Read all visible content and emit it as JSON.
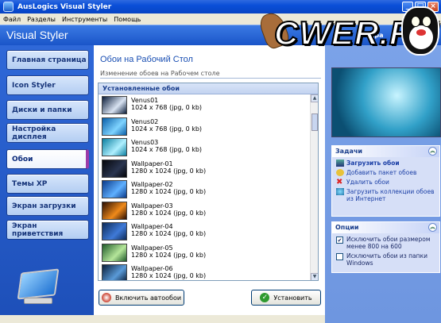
{
  "window": {
    "title": "AusLogics Visual Styler",
    "min": "_",
    "max": "□",
    "close": "×"
  },
  "menu": [
    "Файл",
    "Разделы",
    "Инструменты",
    "Помощь"
  ],
  "header": {
    "app_title": "Visual Styler",
    "help_text": "Спра"
  },
  "logo": {
    "text": "CWER.RU"
  },
  "sidebar": {
    "items": [
      "Главная страница",
      "Icon Styler",
      "Диски и папки",
      "Настройка дисплея",
      "Обои",
      "Темы XP",
      "Экран загрузки",
      "Экран приветствия"
    ],
    "active_index": 4
  },
  "main": {
    "title": "Обои на Рабочий Стол",
    "subtitle": "Изменение обоев на Рабочем столе",
    "list_header": "Установленные обои",
    "items": [
      {
        "name": "Venus01",
        "info": "1024 x 768  (jpg, 0 kb)",
        "c1": "#0b1d3a",
        "c2": "#d9e3f2"
      },
      {
        "name": "Venus02",
        "info": "1024 x 768  (jpg, 0 kb)",
        "c1": "#0a5ea8",
        "c2": "#7fd4ff"
      },
      {
        "name": "Venus03",
        "info": "1024 x 768  (jpg, 0 kb)",
        "c1": "#0c7fa0",
        "c2": "#aff0ff"
      },
      {
        "name": "Wallpaper-01",
        "info": "1280 x 1024  (jpg, 0 kb)",
        "c1": "#05060a",
        "c2": "#2a3550"
      },
      {
        "name": "Wallpaper-02",
        "info": "1280 x 1024  (jpg, 0 kb)",
        "c1": "#0a3a8a",
        "c2": "#5fb0ff"
      },
      {
        "name": "Wallpaper-03",
        "info": "1280 x 1024  (jpg, 0 kb)",
        "c1": "#2a0e02",
        "c2": "#f08a1a"
      },
      {
        "name": "Wallpaper-04",
        "info": "1280 x 1024  (jpg, 0 kb)",
        "c1": "#0d2a58",
        "c2": "#3f7ad8"
      },
      {
        "name": "Wallpaper-05",
        "info": "1280 x 1024  (jpg, 0 kb)",
        "c1": "#1f5a2a",
        "c2": "#b5e69a"
      },
      {
        "name": "Wallpaper-06",
        "info": "1280 x 1024  (jpg, 0 kb)",
        "c1": "#0a1f3a",
        "c2": "#5a9ad8"
      }
    ],
    "buttons": {
      "autochange": "Включить автообои",
      "install": "Установить"
    }
  },
  "tasks": {
    "title": "Задачи",
    "items": [
      "Загрузить обои",
      "Добавить пакет обоев",
      "Удалить обои",
      "Загрузить коллекции обоев из Интернет"
    ]
  },
  "options": {
    "title": "Опции",
    "items": [
      {
        "label": "Исключить обои размером менее 800 на 600",
        "checked": true
      },
      {
        "label": "Исключить обои из папки Windows",
        "checked": false
      }
    ]
  },
  "colors": {
    "accent": "#1a55c8",
    "active_marker": "#9b3ba8"
  }
}
